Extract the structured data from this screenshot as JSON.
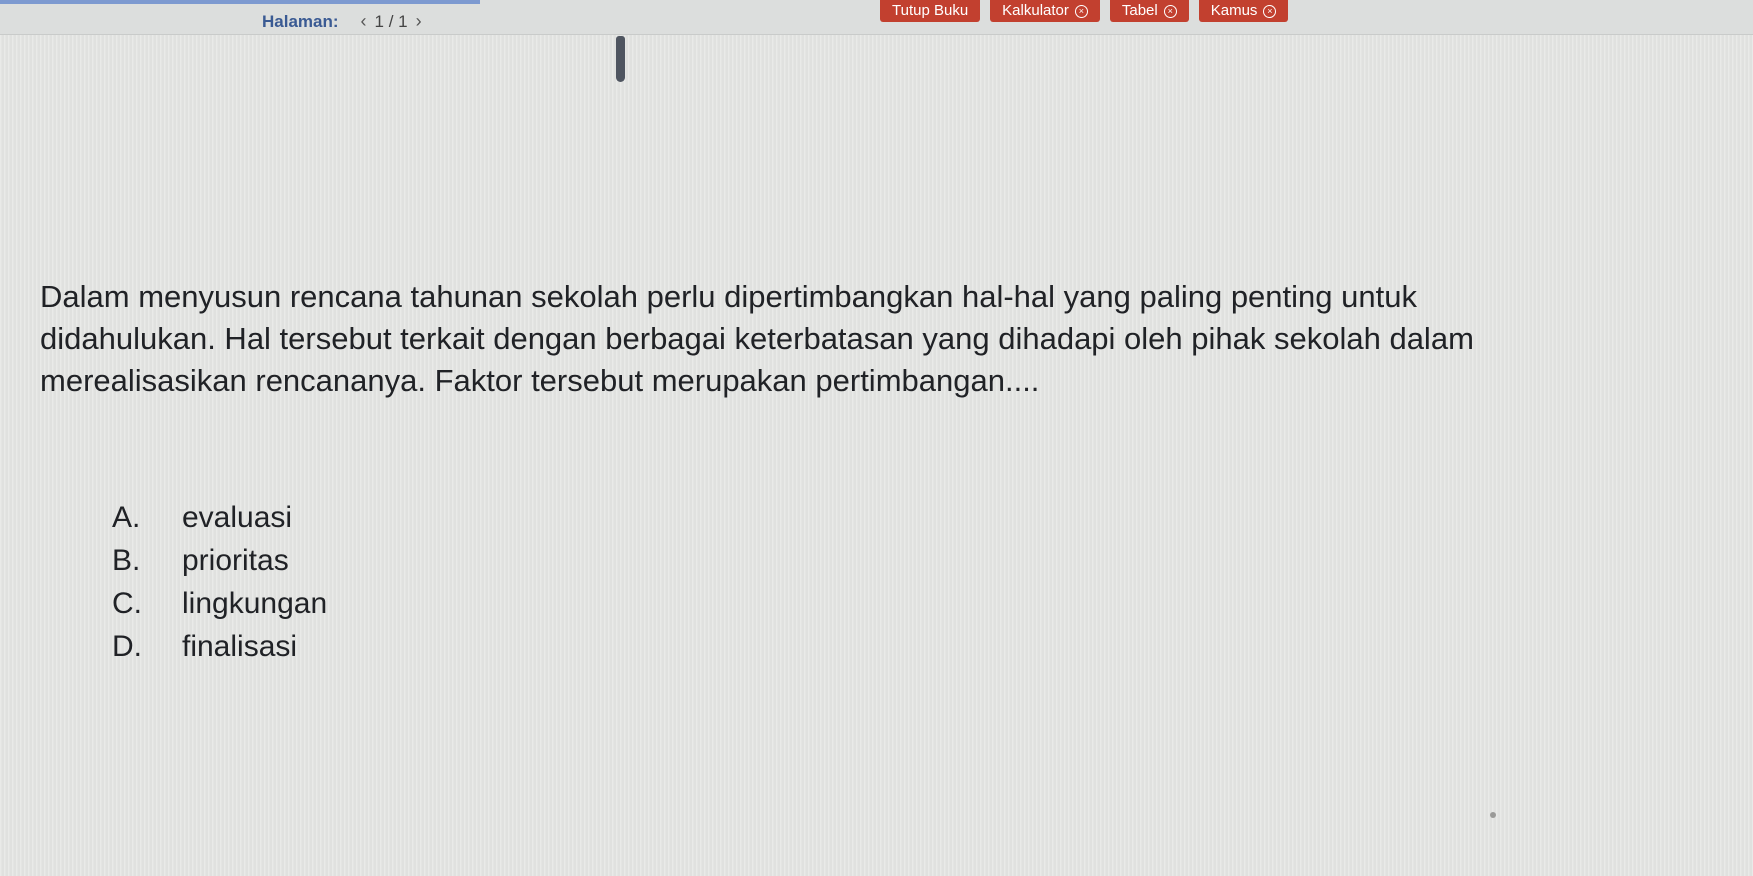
{
  "header": {
    "pager_label": "Halaman:",
    "prev_icon": "‹",
    "page_indicator": "1 / 1",
    "next_icon": "›",
    "tools": [
      {
        "label": "Tutup Buku",
        "closable": false
      },
      {
        "label": "Kalkulator",
        "closable": true
      },
      {
        "label": "Tabel",
        "closable": true
      },
      {
        "label": "Kamus",
        "closable": true
      }
    ],
    "close_glyph": "×"
  },
  "question": {
    "text": "Dalam menyusun rencana tahunan sekolah perlu dipertimbangkan hal-hal yang paling penting untuk didahulukan. Hal tersebut terkait dengan berbagai keterbatasan yang dihadapi oleh pihak sekolah dalam merealisasikan rencananya. Faktor tersebut merupakan pertimbangan....",
    "options": [
      {
        "letter": "A.",
        "text": "evaluasi"
      },
      {
        "letter": "B.",
        "text": "prioritas"
      },
      {
        "letter": "C.",
        "text": "lingkungan"
      },
      {
        "letter": "D.",
        "text": "finalisasi"
      }
    ]
  },
  "colors": {
    "tool_button": "#c2402f",
    "pager_text": "#3a5a93",
    "body_text": "#202226"
  }
}
